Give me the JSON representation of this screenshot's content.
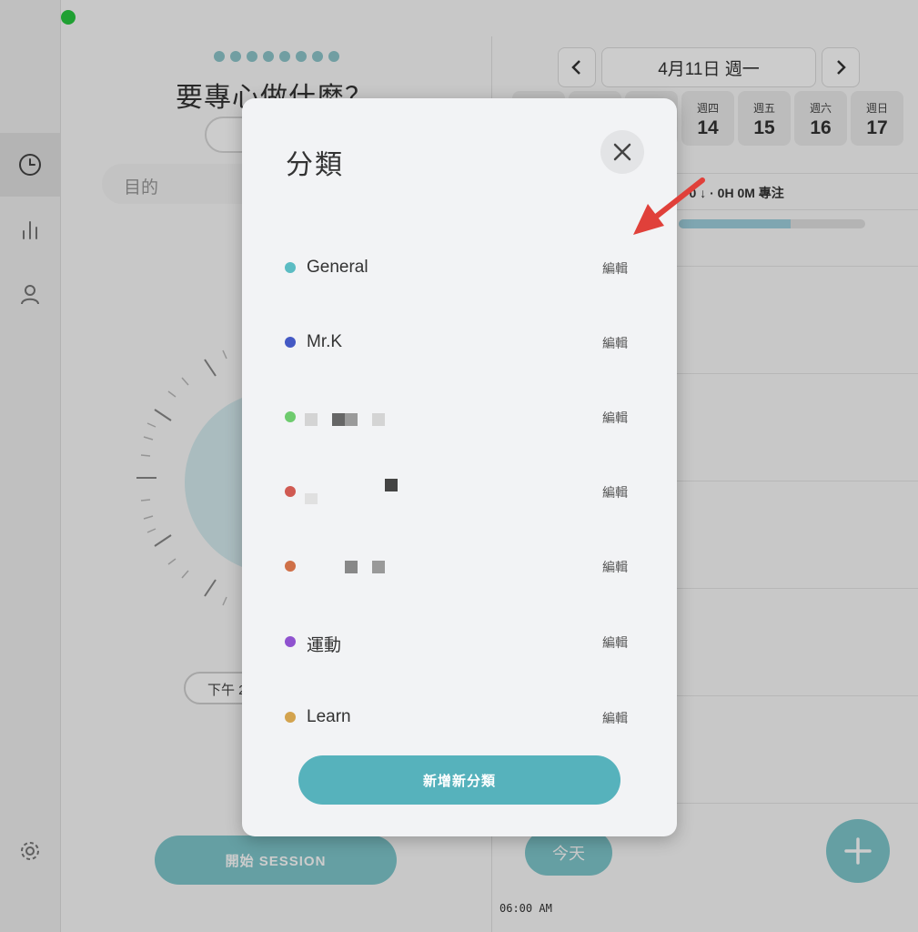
{
  "left_panel": {
    "question_title": "要專心做什麼？",
    "purpose_placeholder": "目的",
    "start_time": "下午 2",
    "start_button": "開始 SESSION"
  },
  "right_panel": {
    "date_label": "4月11日 週一",
    "days": [
      {
        "weekday": "週四",
        "day": "14"
      },
      {
        "weekday": "週五",
        "day": "15"
      },
      {
        "weekday": "週六",
        "day": "16"
      },
      {
        "weekday": "週日",
        "day": "17"
      }
    ],
    "focus_summary": "· 0 ↓ · 0H 0M 專注",
    "today_button": "今天",
    "time_label": "06:00 AM"
  },
  "modal": {
    "title": "分類",
    "edit_label": "編輯",
    "categories": [
      {
        "name": "General",
        "color": "#5bbcc3"
      },
      {
        "name": "Mr.K",
        "color": "#4459c4"
      },
      {
        "name": "",
        "color": "#6ecb6e"
      },
      {
        "name": "",
        "color": "#d05a52"
      },
      {
        "name": "",
        "color": "#cf7048"
      },
      {
        "name": "運動",
        "color": "#8f52cf"
      },
      {
        "name": "Learn",
        "color": "#d3a34e"
      }
    ],
    "add_button": "新增新分類"
  },
  "colors": {
    "accent": "#56b2bc",
    "arrow": "#e0403a"
  },
  "icons": [
    "clock-icon",
    "bar-chart-icon",
    "user-icon",
    "gear-icon",
    "close-icon",
    "chevron-left-icon",
    "chevron-right-icon",
    "plus-icon"
  ]
}
